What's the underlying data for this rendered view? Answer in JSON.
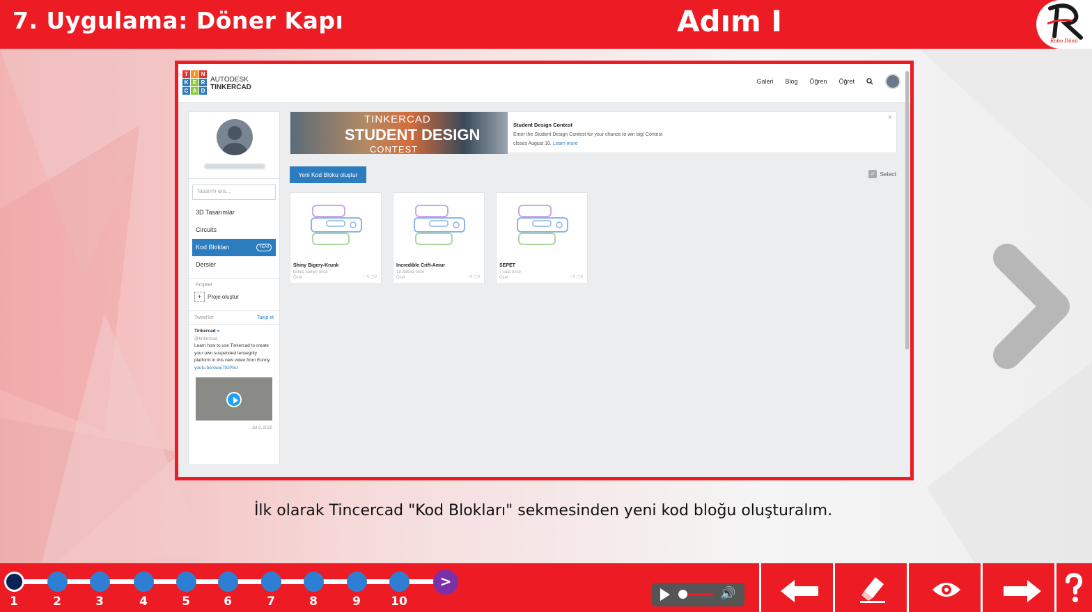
{
  "header": {
    "title": "7. Uygulama: Döner Kapı",
    "step": "Adım I",
    "logo_text": "Robo Dünü"
  },
  "screenshot": {
    "brand_line1": "AUTODESK",
    "brand_line2": "TINKERCAD",
    "logo_letters": [
      "T",
      "I",
      "N",
      "K",
      "E",
      "R",
      "C",
      "A",
      "D"
    ],
    "nav": [
      "Galeri",
      "Blog",
      "Öğren",
      "Öğret"
    ],
    "sidebar": {
      "search_placeholder": "Tasarım ara...",
      "items": [
        "3D Tasarımlar",
        "Circuits",
        "Kod Blokları",
        "Dersler"
      ],
      "active_badge": "YENİ",
      "projects_label": "Projeler",
      "create_project": "Proje oluştur",
      "tweets_label": "Tweet'ler",
      "follow": "Takip et",
      "tweet": {
        "name": "Tinkercad",
        "handle": "@tinkercad",
        "text": "Learn how to use Tinkercad to create your own suspended tensegrity platform in this new video from Eunny.",
        "link": "youtu.be/swai79zPbU",
        "date": "Jul 3, 2020"
      }
    },
    "banner": {
      "img_line1": "TINKERCAD",
      "img_line2": "STUDENT DESIGN",
      "img_line3": "CONTEST",
      "title": "Student Design Contest",
      "text1": "Enter the Student Design Contest for your chance to win big! Contest",
      "text2": "closes August 10.",
      "link": "Learn more",
      "close": "×"
    },
    "new_button": "Yeni Kod Bloku oluştur",
    "select": "Select",
    "cards": [
      {
        "name": "Shiny Bigery-Krunk",
        "time": "birkaç saniye önce",
        "privacy": "Özel",
        "stats": "♡0 ▢0"
      },
      {
        "name": "Incredible Crift-Amur",
        "time": "13 dakika önce",
        "privacy": "Özel",
        "stats": "♡0 ▢0"
      },
      {
        "name": "SEPET",
        "time": "7 saat önce",
        "privacy": "Özel",
        "stats": "♡0 ▢0"
      }
    ]
  },
  "caption": "İlk olarak Tincercad \"Kod Blokları\" sekmesinden yeni kod bloğu oluşturalım.",
  "progress": {
    "steps": [
      "1",
      "2",
      "3",
      "4",
      "5",
      "6",
      "7",
      "8",
      "9",
      "10"
    ],
    "current": 1,
    "next_symbol": ">"
  },
  "player": {
    "volume_symbol": "🔊",
    "position": 0.0
  },
  "colors": {
    "accent": "#ed1c24",
    "dot": "#2e7fd4",
    "current_dot": "#0b2254",
    "next_dot": "#7b2fa8",
    "tinkercad_blue": "#2c7cc0"
  },
  "icons": [
    "back-arrow-icon",
    "eraser-icon",
    "eye-icon",
    "forward-arrow-icon",
    "question-icon"
  ]
}
